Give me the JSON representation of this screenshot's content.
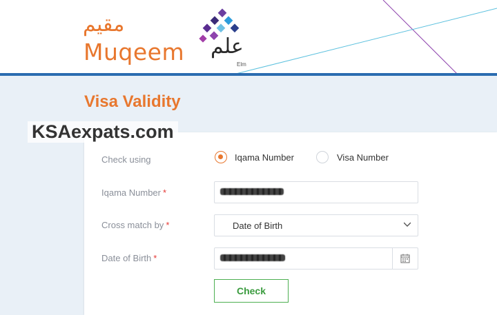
{
  "header": {
    "muqeem_logo_arabic": "مقيم",
    "muqeem_logo_english": "Muqeem",
    "elm_logo_arabic": "علم",
    "elm_logo_english": "Elm",
    "brand_color": "#e8772e",
    "divider_color": "#2b6cb0"
  },
  "page": {
    "title": "Visa Validity",
    "watermark": "KSAexpats.com"
  },
  "form": {
    "check_using": {
      "label": "Check using",
      "options": [
        {
          "label": "Iqama Number",
          "selected": true
        },
        {
          "label": "Visa Number",
          "selected": false
        }
      ]
    },
    "iqama_number": {
      "label": "Iqama Number",
      "required_mark": "*"
    },
    "cross_match_by": {
      "label": "Cross match by",
      "required_mark": "*",
      "selected": "Date of Birth"
    },
    "date_of_birth": {
      "label": "Date of Birth",
      "required_mark": "*"
    },
    "check_button": {
      "label": "Check",
      "color": "#4caf50"
    }
  }
}
